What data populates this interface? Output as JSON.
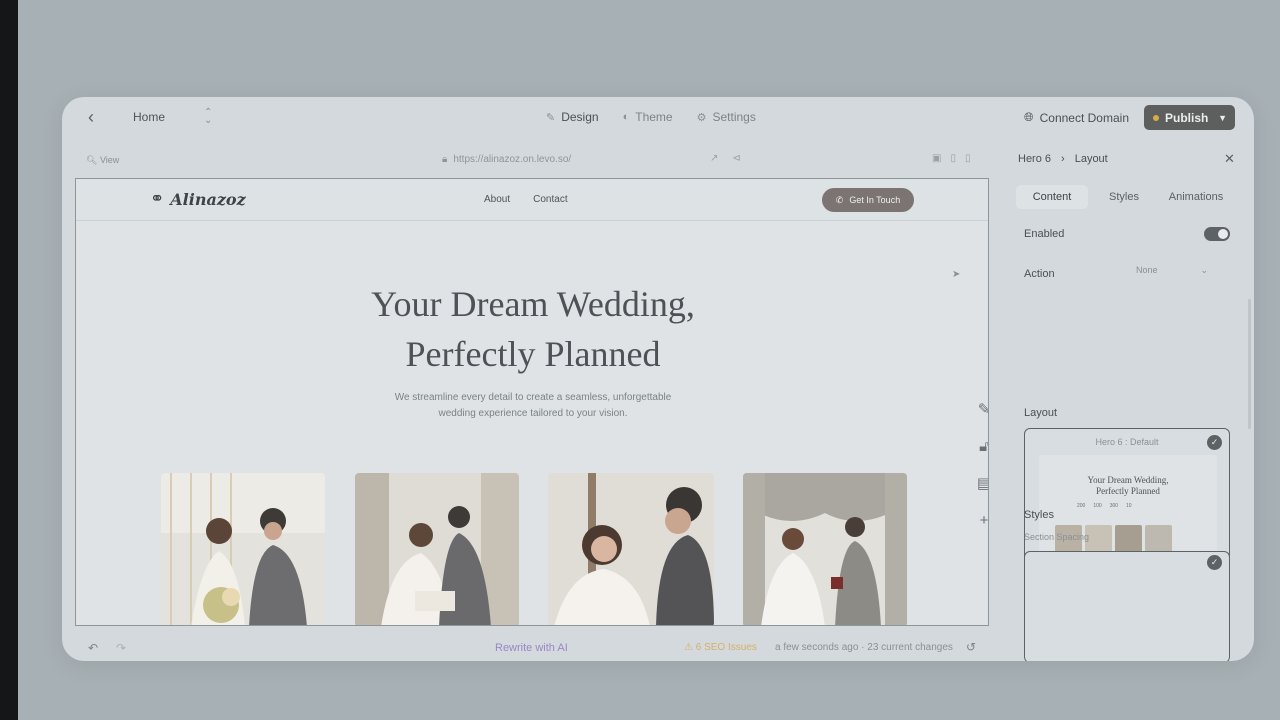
{
  "topbar": {
    "page_name": "Home",
    "tabs": [
      {
        "label": "Design",
        "icon": "brush-icon",
        "active": true
      },
      {
        "label": "Theme",
        "icon": "palette-icon",
        "active": false
      },
      {
        "label": "Settings",
        "icon": "gear-icon",
        "active": false
      }
    ],
    "connect_domain": "Connect Domain",
    "publish": "Publish"
  },
  "canvas": {
    "view_label": "View",
    "url": "https://alinazoz.on.levo.so/"
  },
  "site": {
    "logo": "Alinazoz",
    "nav_links": [
      "About",
      "Contact"
    ],
    "cta": "Get In Touch",
    "hero_title_line1": "Your Dream Wedding,",
    "hero_title_line2": "Perfectly Planned",
    "hero_sub_line1": "We streamline every detail to create a seamless, unforgettable",
    "hero_sub_line2": "wedding experience tailored to your vision."
  },
  "bottombar": {
    "rewrite": "Rewrite with AI",
    "seo": "6 SEO Issues",
    "saved": "a few seconds ago · 23 current changes"
  },
  "panel": {
    "breadcrumb_parent": "Hero 6",
    "breadcrumb_current": "Layout",
    "tabs": [
      "Content",
      "Styles",
      "Animations"
    ],
    "enabled_label": "Enabled",
    "enabled": true,
    "action_label": "Action",
    "action_value": "None",
    "layout_label": "Layout",
    "layout_card_name": "Hero 6 : Default",
    "mini_title_line1": "Your Dream Wedding,",
    "mini_title_line2": "Perfectly Planned",
    "mini_stats": [
      "200",
      "100",
      "300",
      "10"
    ],
    "styles_label": "Styles",
    "section_spacing_label": "Section Spacing"
  },
  "colors": {
    "publish_bg": "#5d5f5f",
    "cta_bg": "#7b7473",
    "rewrite_ai": "#9b86c8",
    "seo_warning": "#d6b06a"
  }
}
